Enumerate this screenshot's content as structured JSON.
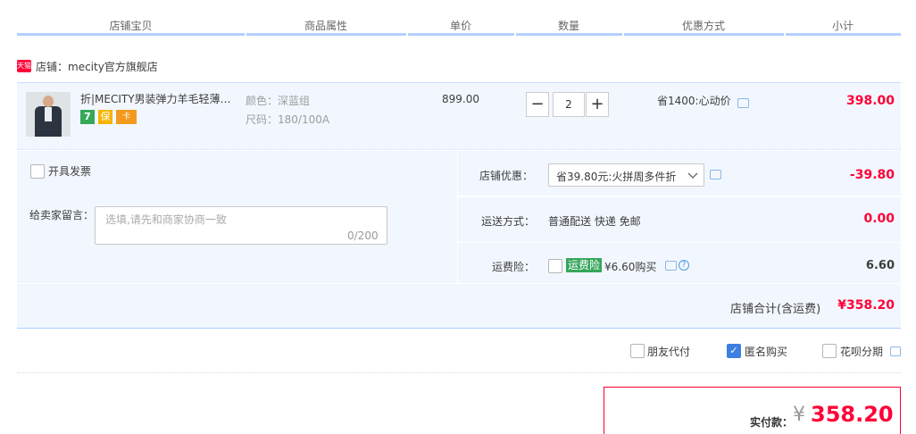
{
  "columns": [
    "店铺宝贝",
    "商品属性",
    "单价",
    "数量",
    "优惠方式",
    "小计"
  ],
  "shop": {
    "logo_text": "天猫",
    "name": "店铺：mecity官方旗舰店"
  },
  "item": {
    "title": "折|MECITY男装弹力羊毛轻薄…",
    "badges": [
      "7",
      "保",
      "卡"
    ],
    "color": "颜色：深蓝组",
    "size": "尺码：180/100A",
    "unit_price": "899.00",
    "quantity": "2",
    "minus": "−",
    "plus": "+",
    "promo": "省1400:心动价",
    "subtotal": "398.00"
  },
  "invoice": {
    "label": "开具发票"
  },
  "message": {
    "label": "给卖家留言：",
    "placeholder": "选填,请先和商家协商一致",
    "count": "0/200"
  },
  "shop_discount": {
    "label": "店铺优惠：",
    "selected": "省39.80元:火拼周多件折",
    "value": "-39.80"
  },
  "shipping": {
    "label": "运送方式：",
    "method": "普通配送 快递 免邮",
    "value": "0.00"
  },
  "insurance": {
    "label": "运费险：",
    "tag": "运费险",
    "text": "¥6.60购买",
    "value": "6.60"
  },
  "shop_total": {
    "label": "店铺合计(含运费)",
    "value": "¥358.20"
  },
  "options": {
    "friend_pay": "朋友代付",
    "anonymous": "匿名购买",
    "huabei": "花呗分期"
  },
  "payment": {
    "label": "实付款：",
    "currency": "¥",
    "amount": "358.20"
  },
  "colors": {
    "accent_red": "#ff0036",
    "light_blue_bg": "#f2f7ff",
    "header_line": "#b2d1ff",
    "check_blue": "#3d7ee1",
    "insurance_green": "#35a65b"
  }
}
